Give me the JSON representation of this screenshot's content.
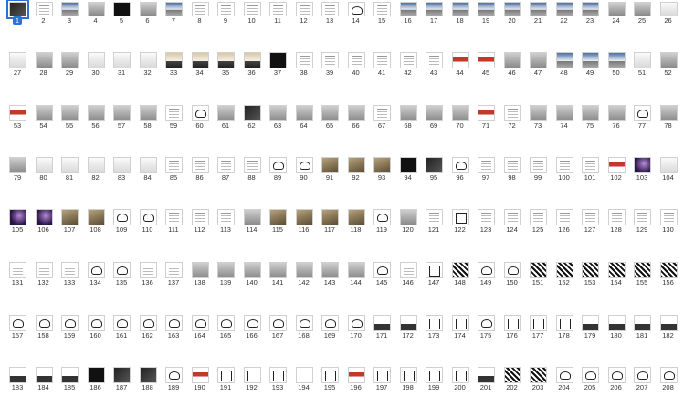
{
  "selected_page": "1",
  "rows": [
    {
      "labels": [
        "1",
        "2",
        "3",
        "4",
        "5",
        "6",
        "7",
        "8",
        "9",
        "10",
        "11",
        "12",
        "13",
        "14",
        "15",
        "16",
        "17",
        "18",
        "19",
        "20",
        "21",
        "22",
        "23",
        "24",
        "25",
        "26"
      ],
      "kinds": [
        "t-dark",
        "t-doc",
        "t-sky",
        "t-gray",
        "t-darker",
        "t-gray",
        "t-sky",
        "t-doc",
        "t-doc",
        "t-doc",
        "t-doc",
        "t-doc",
        "t-doc",
        "t-icon",
        "t-doc",
        "t-sky",
        "t-sky",
        "t-sky",
        "t-sky",
        "t-sky",
        "t-sky",
        "t-sky",
        "t-sky",
        "t-gray",
        "t-gray",
        "t-lite"
      ]
    },
    {
      "labels": [
        "27",
        "28",
        "29",
        "30",
        "31",
        "32",
        "33",
        "34",
        "35",
        "36",
        "37",
        "38",
        "39",
        "40",
        "41",
        "42",
        "43",
        "44",
        "45",
        "46",
        "47",
        "48",
        "49",
        "50",
        "51",
        "52"
      ],
      "kinds": [
        "t-lite",
        "t-gray",
        "t-gray",
        "t-lite",
        "t-lite",
        "t-lite",
        "t-sunset",
        "t-sunset",
        "t-sunset",
        "t-sunset",
        "t-darker",
        "t-doc",
        "t-doc",
        "t-doc",
        "t-doc",
        "t-doc",
        "t-doc",
        "t-red",
        "t-red",
        "t-gray",
        "t-gray",
        "t-sky",
        "t-sky",
        "t-sky",
        "t-lite",
        "t-gray"
      ]
    },
    {
      "labels": [
        "53",
        "54",
        "55",
        "56",
        "57",
        "58",
        "59",
        "60",
        "61",
        "62",
        "63",
        "64",
        "65",
        "66",
        "67",
        "68",
        "69",
        "70",
        "71",
        "72",
        "73",
        "74",
        "75",
        "76",
        "77",
        "78"
      ],
      "kinds": [
        "t-red",
        "t-gray",
        "t-gray",
        "t-gray",
        "t-gray",
        "t-gray",
        "t-doc",
        "t-icon",
        "t-gray",
        "t-dark",
        "t-gray",
        "t-gray",
        "t-gray",
        "t-gray",
        "t-doc",
        "t-gray",
        "t-gray",
        "t-gray",
        "t-red",
        "t-doc",
        "t-gray",
        "t-gray",
        "t-gray",
        "t-gray",
        "t-icon",
        "t-gray"
      ]
    },
    {
      "labels": [
        "79",
        "80",
        "81",
        "82",
        "83",
        "84",
        "85",
        "86",
        "87",
        "88",
        "89",
        "90",
        "91",
        "92",
        "93",
        "94",
        "95",
        "96",
        "97",
        "98",
        "99",
        "100",
        "101",
        "102",
        "103",
        "104"
      ],
      "kinds": [
        "t-gray",
        "t-lite",
        "t-lite",
        "t-lite",
        "t-lite",
        "t-lite",
        "t-doc",
        "t-doc",
        "t-doc",
        "t-doc",
        "t-icon",
        "t-icon",
        "t-sand",
        "t-sand",
        "t-sand",
        "t-darker",
        "t-dark",
        "t-icon",
        "t-doc",
        "t-doc",
        "t-doc",
        "t-doc",
        "t-doc",
        "t-red",
        "t-purple",
        "t-lite"
      ]
    },
    {
      "labels": [
        "105",
        "106",
        "107",
        "108",
        "109",
        "110",
        "111",
        "112",
        "113",
        "114",
        "115",
        "116",
        "117",
        "118",
        "119",
        "120",
        "121",
        "122",
        "123",
        "124",
        "125",
        "126",
        "127",
        "128",
        "129",
        "130"
      ],
      "kinds": [
        "t-purple",
        "t-purple",
        "t-sand",
        "t-sand",
        "t-icon",
        "t-icon",
        "t-doc",
        "t-doc",
        "t-doc",
        "t-gray",
        "t-sand",
        "t-sand",
        "t-sand",
        "t-sand",
        "t-icon",
        "t-gray",
        "t-doc",
        "t-frame",
        "t-doc",
        "t-doc",
        "t-doc",
        "t-doc",
        "t-doc",
        "t-doc",
        "t-doc",
        "t-doc"
      ]
    },
    {
      "labels": [
        "131",
        "132",
        "133",
        "134",
        "135",
        "136",
        "137",
        "138",
        "139",
        "140",
        "141",
        "142",
        "143",
        "144",
        "145",
        "146",
        "147",
        "148",
        "149",
        "150",
        "151",
        "152",
        "153",
        "154",
        "155",
        "156"
      ],
      "kinds": [
        "t-doc",
        "t-doc",
        "t-doc",
        "t-icon",
        "t-icon",
        "t-doc",
        "t-doc",
        "t-gray",
        "t-gray",
        "t-gray",
        "t-gray",
        "t-gray",
        "t-gray",
        "t-gray",
        "t-icon",
        "t-doc",
        "t-frame",
        "t-pat",
        "t-icon",
        "t-icon",
        "t-pat",
        "t-pat",
        "t-pat",
        "t-pat",
        "t-pat",
        "t-pat"
      ]
    },
    {
      "labels": [
        "157",
        "158",
        "159",
        "160",
        "161",
        "162",
        "163",
        "164",
        "165",
        "166",
        "167",
        "168",
        "169",
        "170",
        "171",
        "172",
        "173",
        "174",
        "175",
        "176",
        "177",
        "178",
        "179",
        "180",
        "181",
        "182"
      ],
      "kinds": [
        "t-icon",
        "t-icon",
        "t-icon",
        "t-icon",
        "t-icon",
        "t-icon",
        "t-icon",
        "t-icon",
        "t-icon",
        "t-icon",
        "t-icon",
        "t-icon",
        "t-icon",
        "t-icon",
        "t-hill",
        "t-hill",
        "t-frame",
        "t-frame",
        "t-icon",
        "t-frame",
        "t-frame",
        "t-frame",
        "t-hill",
        "t-hill",
        "t-hill",
        "t-hill"
      ]
    },
    {
      "labels": [
        "183",
        "184",
        "185",
        "186",
        "187",
        "188",
        "189",
        "190",
        "191",
        "192",
        "193",
        "194",
        "195",
        "196",
        "197",
        "198",
        "199",
        "200",
        "201",
        "202",
        "203",
        "204",
        "205",
        "206",
        "207",
        "208"
      ],
      "kinds": [
        "t-hill",
        "t-hill",
        "t-hill",
        "t-darker",
        "t-dark",
        "t-dark",
        "t-icon",
        "t-red",
        "t-frame",
        "t-frame",
        "t-frame",
        "t-frame",
        "t-frame",
        "t-red",
        "t-frame",
        "t-frame",
        "t-frame",
        "t-frame",
        "t-hill",
        "t-pat",
        "t-pat",
        "t-icon",
        "t-icon",
        "t-icon",
        "t-icon",
        "t-icon"
      ]
    }
  ]
}
